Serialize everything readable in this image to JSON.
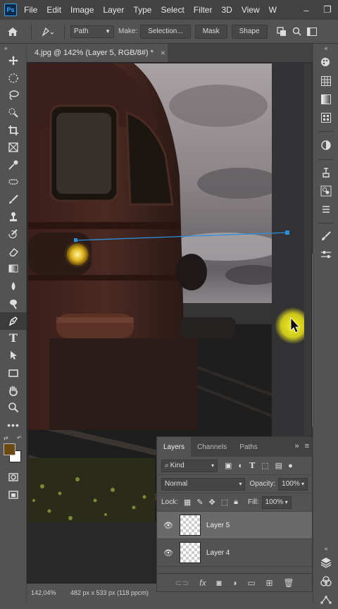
{
  "app": {
    "logo_text": "Ps"
  },
  "menu": [
    "File",
    "Edit",
    "Image",
    "Layer",
    "Type",
    "Select",
    "Filter",
    "3D",
    "View",
    "W"
  ],
  "options_bar": {
    "mode_value": "Path",
    "make_label": "Make:",
    "selection_button": "Selection...",
    "mask_button": "Mask",
    "shape_button": "Shape"
  },
  "document": {
    "tab_title": "4.jpg @ 142% (Layer 5, RGB/8#) *",
    "close_glyph": "×"
  },
  "status": {
    "zoom": "142,04%",
    "doc_info": "482 px x 533 px (118 ppcm)"
  },
  "layers_panel": {
    "tabs": [
      "Layers",
      "Channels",
      "Paths"
    ],
    "active_tab": "Layers",
    "filter_value": "Kind",
    "blend_mode": "Normal",
    "opacity_label": "Opacity:",
    "opacity_value": "100%",
    "lock_label": "Lock:",
    "fill_label": "Fill:",
    "fill_value": "100%",
    "layers": [
      {
        "name": "Layer 5",
        "selected": true
      },
      {
        "name": "Layer 4",
        "selected": false
      }
    ],
    "footer_link": "⊖⊖",
    "footer_fx": "fx"
  },
  "colors": {
    "foreground": "#6b4a12",
    "background": "#ffffff",
    "path_line": "#2a8fdc",
    "cursor_highlight": "#f4f020"
  }
}
